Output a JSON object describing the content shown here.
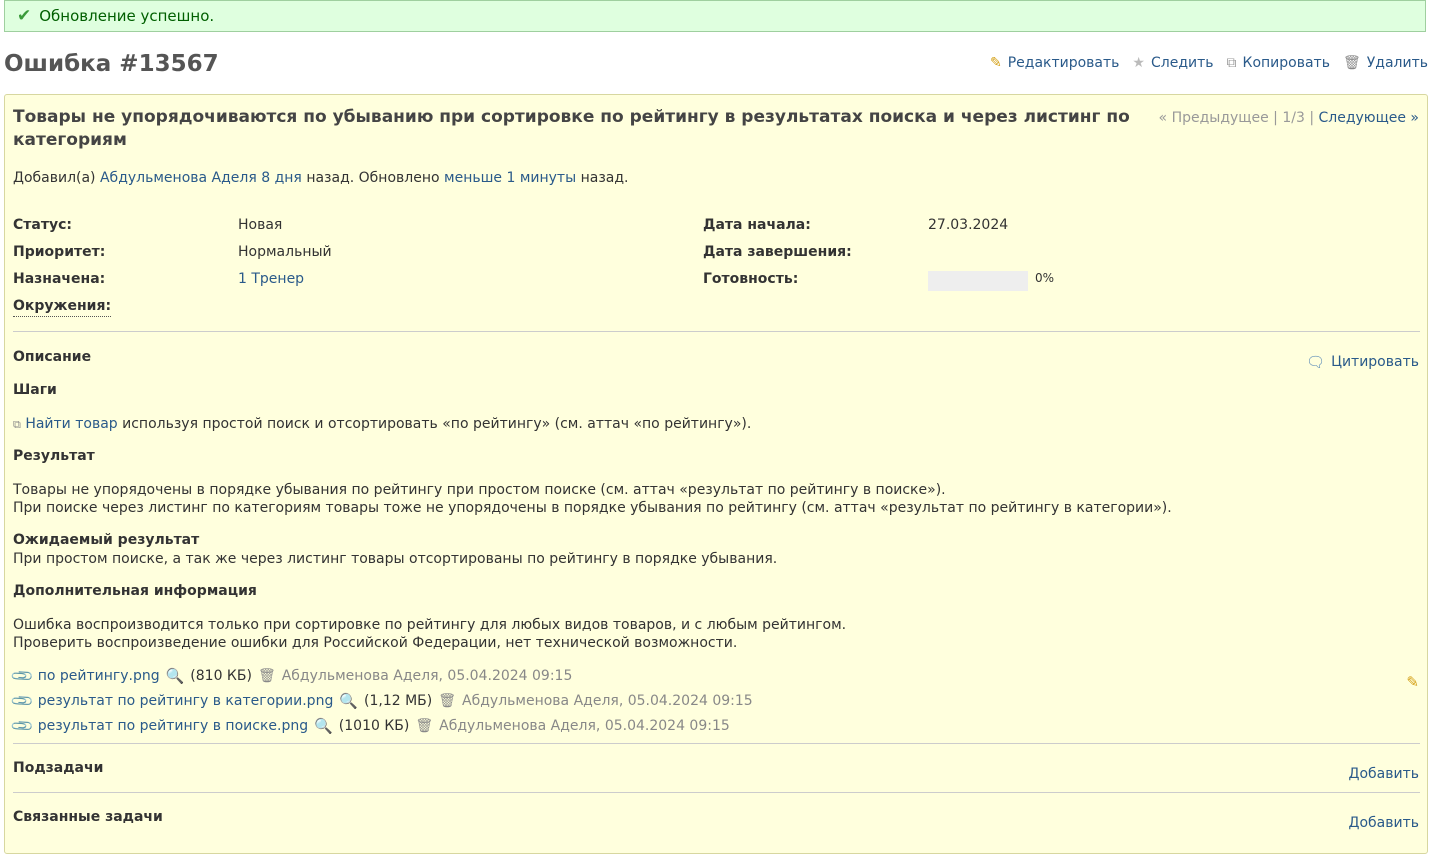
{
  "flash": {
    "icon": "check-icon",
    "text": "Обновление успешно."
  },
  "page": {
    "title": "Ошибка #13567"
  },
  "contextual": [
    {
      "icon": "pencil-icon",
      "label": "Редактировать"
    },
    {
      "icon": "star-icon",
      "label": "Следить"
    },
    {
      "icon": "copy-icon",
      "label": "Копировать"
    },
    {
      "icon": "trash-icon",
      "label": "Удалить"
    }
  ],
  "issue": {
    "subject": "Товары не упорядочиваются по убыванию при сортировке по рейтингу в результатах поиска и через листинг по категориям",
    "nav": {
      "prev": "« Предыдущее",
      "sep1": "|",
      "position": "1/3",
      "sep2": "|",
      "next": "Следующее »"
    },
    "author_line": {
      "prefix": "Добавил(а)",
      "author": "Абдульменова Аделя",
      "added": "8 дня",
      "mid": "назад. Обновлено",
      "updated": "меньше 1 минуты",
      "suffix": "назад."
    },
    "attributes": {
      "status_label": "Статус:",
      "status_value": "Новая",
      "priority_label": "Приоритет:",
      "priority_value": "Нормальный",
      "assigned_label": "Назначена:",
      "assigned_value": "1 Тренер",
      "env_label": "Окружения:",
      "start_label": "Дата начала:",
      "start_value": "27.03.2024",
      "due_label": "Дата завершения:",
      "done_label": "Готовность:",
      "done_value": "0%",
      "done_fraction": 0
    },
    "description": {
      "heading": "Описание",
      "quote_icon": "speech-bubble-icon",
      "quote_label": "Цитировать",
      "steps_heading": "Шаги",
      "steps_icon": "external-link-icon",
      "steps_link": "Найти товар",
      "steps_text": "используя простой поиск и отсортировать «по рейтингу» (см. аттач «по рейтингу»).",
      "result_heading": "Результат",
      "result_line1": "Товары не упорядочены в порядке убывания по рейтингу при простом поиске (см. аттач «результат по рейтингу в поиске»).",
      "result_line2": "При поиске через листинг по категориям товары тоже не упорядочены в порядке убывания по рейтингу (см. аттач «результат по рейтингу в категории»).",
      "expected_heading": "Ожидаемый результат",
      "expected_text": "При простом поиске, а так же через листинг товары отсортированы по рейтингу в порядке убывания.",
      "extra_heading": "Дополнительная информация",
      "extra_line1": "Ошибка воспроизводится только при сортировке по рейтингу для любых видов товаров, и с любым рейтингом.",
      "extra_line2": "Проверить воспроизведение ошибки для Российской Федерации, нет технической возможности."
    },
    "attachments": [
      {
        "name": "по рейтингу.png",
        "size": "(810 КБ)",
        "meta": "Абдульменова Аделя, 05.04.2024 09:15"
      },
      {
        "name": "результат по рейтингу в категории.png",
        "size": "(1,12 МБ)",
        "meta": "Абдульменова Аделя, 05.04.2024 09:15"
      },
      {
        "name": "результат по рейтингу в поиске.png",
        "size": "(1010 КБ)",
        "meta": "Абдульменова Аделя, 05.04.2024 09:15"
      }
    ],
    "subtasks": {
      "heading": "Подзадачи",
      "add": "Добавить"
    },
    "relations": {
      "heading": "Связанные задачи",
      "add": "Добавить"
    }
  }
}
